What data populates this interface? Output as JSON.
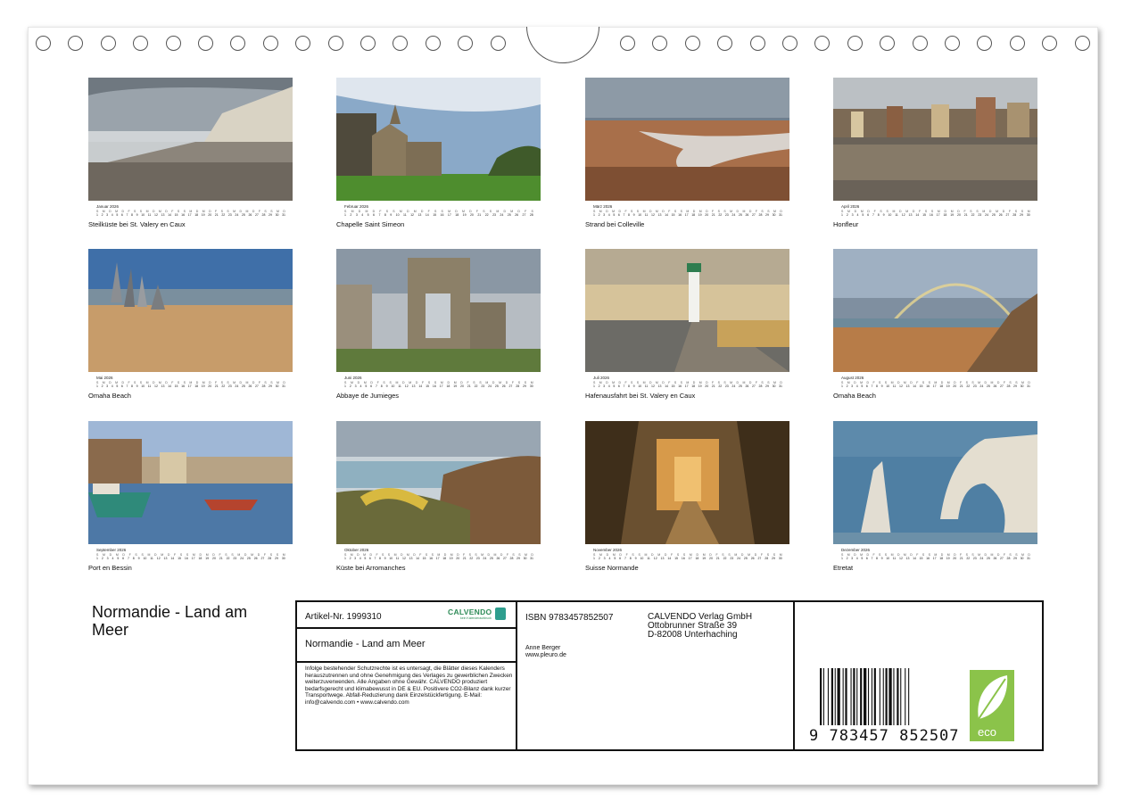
{
  "months": [
    {
      "name": "Januar 2026",
      "caption": "Steilküste bei St. Valery en Caux",
      "scene": "cliff"
    },
    {
      "name": "Februar 2026",
      "caption": "Chapelle Saint Simeon",
      "scene": "chapel"
    },
    {
      "name": "März 2026",
      "caption": "Strand bei Colleville",
      "scene": "tidal"
    },
    {
      "name": "April 2026",
      "caption": "Honfleur",
      "scene": "harbor"
    },
    {
      "name": "Mai 2026",
      "caption": "Omaha Beach",
      "scene": "sculpture"
    },
    {
      "name": "Juni 2026",
      "caption": "Abbaye de Jumieges",
      "scene": "abbey"
    },
    {
      "name": "Juli 2026",
      "caption": "Hafenausfahrt bei St. Valery en Caux",
      "scene": "lighthouse"
    },
    {
      "name": "August 2026",
      "caption": "Omaha Beach",
      "scene": "rainbow"
    },
    {
      "name": "September 2026",
      "caption": "Port en Bessin",
      "scene": "boats"
    },
    {
      "name": "Oktober 2026",
      "caption": "Küste bei Arromanches",
      "scene": "coast"
    },
    {
      "name": "November 2026",
      "caption": "Suisse Normande",
      "scene": "forest"
    },
    {
      "name": "Dezember 2026",
      "caption": "Etretat",
      "scene": "etretat"
    }
  ],
  "weekday_letters": [
    "S",
    "M",
    "D",
    "M",
    "D",
    "F",
    "S"
  ],
  "title": "Normandie - Land am Meer",
  "info": {
    "article": "Artikel-Nr. 1999310",
    "brand": "CALVENDO",
    "brand_sub": "kein Kalenderaufdruck",
    "title": "Normandie - Land am Meer",
    "legal": "Infolge bestehender Schutzrechte ist es untersagt, die Blätter dieses Kalenders herauszutrennen und ohne Genehmigung des Verlages zu gewerblichen Zwecken weiterzuverwenden. Alle Angaben ohne Gewähr. CALVENDO produziert bedarfsgerecht und klimabewusst in DE & EU. Positivere CO2-Bilanz dank kurzer Transportwege. Abfall-Reduzierung dank Einzelstückfertigung. E-Mail: info@calvendo.com • www.calvendo.com",
    "isbn": "ISBN 9783457852507",
    "publisher": [
      "CALVENDO Verlag GmbH",
      "Ottobrunner Straße 39",
      "D-82008 Unterhaching"
    ],
    "author": "Anne Berger",
    "website": "www.pleuro.de",
    "barcode": "9 783457 852507",
    "eco": "eco"
  },
  "colors": {
    "frame": "#111111",
    "eco_green": "#8bc34a",
    "brand_green": "#2e8b57"
  }
}
